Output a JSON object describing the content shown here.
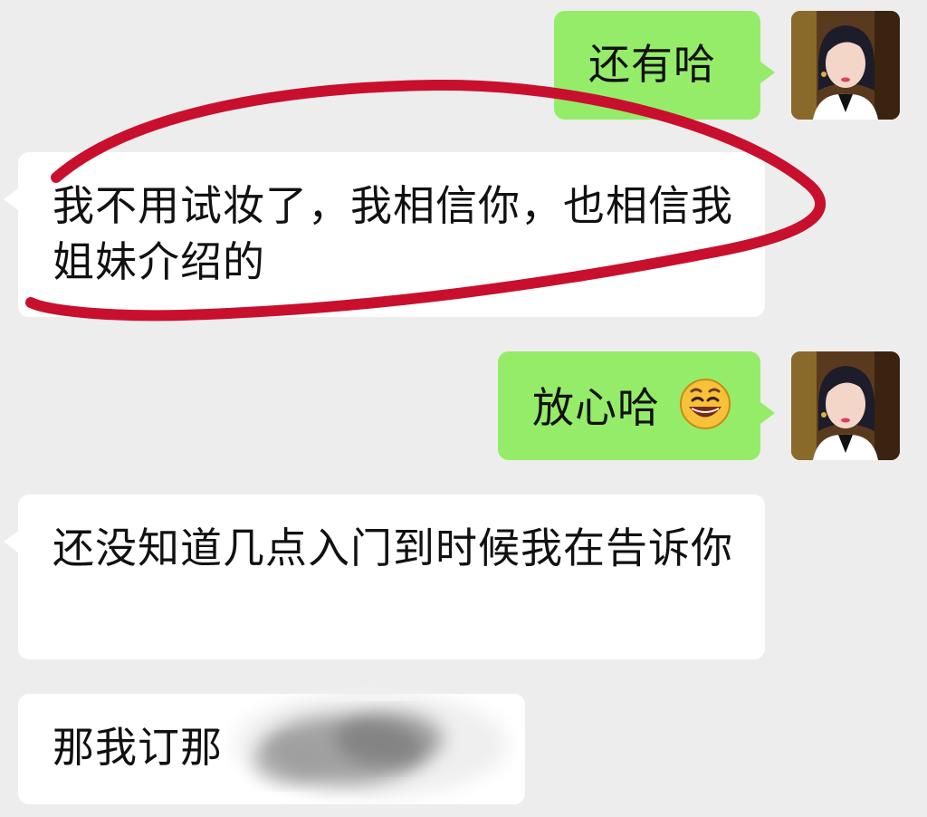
{
  "messages": [
    {
      "id": "m1",
      "side": "sent",
      "text": "还有哈"
    },
    {
      "id": "m2",
      "side": "received",
      "text": "我不用试妆了，我相信你，也相信我姐妹介绍的"
    },
    {
      "id": "m3",
      "side": "sent",
      "text": "放心哈",
      "emoji": "grinning-face-emoji"
    },
    {
      "id": "m4",
      "side": "received",
      "text": "还没知道几点入门到时候我在告诉你"
    },
    {
      "id": "m5",
      "side": "received",
      "text": "那我订那"
    }
  ],
  "colors": {
    "background": "#ededed",
    "sent_bubble": "#95ec69",
    "received_bubble": "#ffffff",
    "annotation": "#c8102e"
  },
  "icons": {
    "avatar": "user-avatar-photo",
    "emoji": "grinning-face-emoji"
  }
}
